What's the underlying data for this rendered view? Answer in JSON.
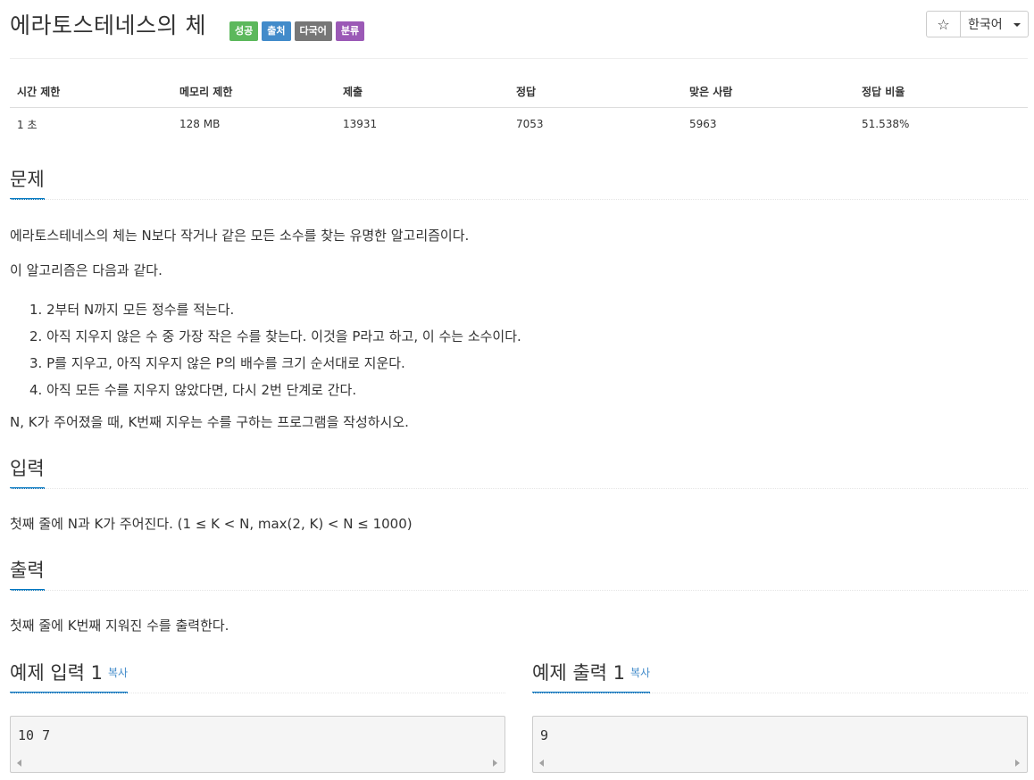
{
  "problem": {
    "title": "에라토스테네스의 체",
    "labels": [
      {
        "text": "성공",
        "color": "#5cb85c"
      },
      {
        "text": "출처",
        "color": "#428bca"
      },
      {
        "text": "다국어",
        "color": "#777777"
      },
      {
        "text": "분류",
        "color": "#9b59b6"
      }
    ]
  },
  "toolbar": {
    "star_label": "☆",
    "language_label": "한국어"
  },
  "info_table": {
    "headers": [
      "시간 제한",
      "메모리 제한",
      "제출",
      "정답",
      "맞은 사람",
      "정답 비율"
    ],
    "values": [
      "1 초",
      "128 MB",
      "13931",
      "7053",
      "5963",
      "51.538%"
    ]
  },
  "sections": {
    "problem_heading": "문제",
    "problem_text_1": "에라토스테네스의 체는 N보다 작거나 같은 모든 소수를 찾는 유명한 알고리즘이다.",
    "problem_text_2": "이 알고리즘은 다음과 같다.",
    "steps": [
      "1. 2부터 N까지 모든 정수를 적는다.",
      "2. 아직 지우지 않은 수 중 가장 작은 수를 찾는다. 이것을 P라고 하고, 이 수는 소수이다.",
      "3. P를 지우고, 아직 지우지 않은 P의 배수를 크기 순서대로 지운다.",
      "4. 아직 모든 수를 지우지 않았다면, 다시 2번 단계로 간다."
    ],
    "problem_text_3": "N, K가 주어졌을 때, K번째 지우는 수를 구하는 프로그램을 작성하시오.",
    "input_heading": "입력",
    "input_text": "첫째 줄에 N과 K가 주어진다. (1 ≤ K < N, max(2, K) < N ≤ 1000)",
    "output_heading": "출력",
    "output_text": "첫째 줄에 K번째 지워진 수를 출력한다."
  },
  "samples": {
    "input_heading": "예제 입력 1",
    "output_heading": "예제 출력 1",
    "copy_label": "복사",
    "input_value": "10 7",
    "output_value": "9"
  }
}
